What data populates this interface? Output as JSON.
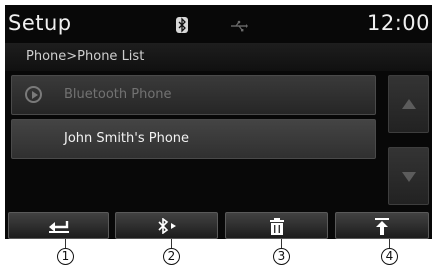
{
  "header": {
    "title": "Setup",
    "clock": "12:00",
    "status_icons": [
      "bluetooth-icon",
      "usb-icon"
    ]
  },
  "breadcrumb": "Phone>Phone List",
  "list": {
    "items": [
      {
        "label": "Bluetooth Phone",
        "icon": "play-icon",
        "state": "disabled"
      },
      {
        "label": "John Smith's Phone",
        "state": "active"
      }
    ]
  },
  "scroll": {
    "up_icon": "triangle-up-icon",
    "down_icon": "triangle-down-icon"
  },
  "bottom_bar": {
    "buttons": [
      {
        "icon": "back-arrow-icon"
      },
      {
        "icon": "bluetooth-connect-icon"
      },
      {
        "icon": "trash-icon"
      },
      {
        "icon": "move-to-top-icon"
      }
    ]
  },
  "callouts": [
    "1",
    "2",
    "3",
    "4"
  ],
  "colors": {
    "screen_bg": "#080808",
    "item_bg": "#333333",
    "text": "#f0f0f0",
    "disabled_text": "#727272"
  }
}
